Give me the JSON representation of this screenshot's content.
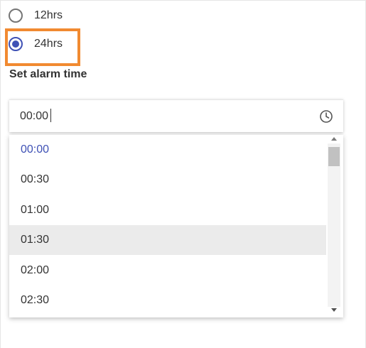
{
  "format_options": [
    {
      "label": "12hrs",
      "checked": false
    },
    {
      "label": "24hrs",
      "checked": true
    }
  ],
  "alarm_label": "Set alarm time",
  "time_input": {
    "value": "00:00"
  },
  "dropdown": {
    "options": [
      "00:00",
      "00:30",
      "01:00",
      "01:30",
      "02:00",
      "02:30"
    ],
    "selected_value": "00:00",
    "hovered_value": "01:30"
  },
  "colors": {
    "accent": "#3f51b5",
    "highlight_border": "#f18a31",
    "hover_bg": "#ebebeb"
  },
  "icons": {
    "time_picker": "clock-icon"
  }
}
